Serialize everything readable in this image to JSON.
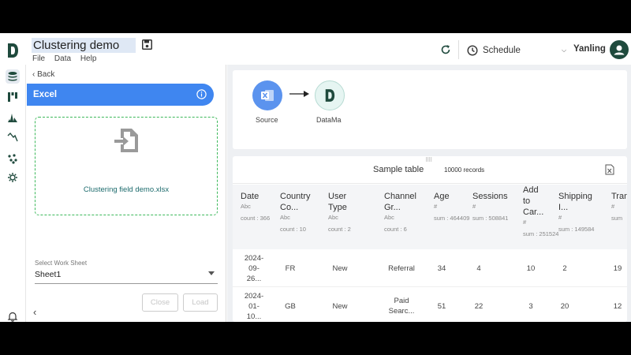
{
  "header": {
    "title": "Clustering demo",
    "menu": [
      "File",
      "Data",
      "Help"
    ],
    "schedule_label": "Schedule",
    "user_name": "Yanling"
  },
  "panel": {
    "back_label": "Back",
    "source_type": "Excel",
    "file_name": "Clustering field demo.xlsx",
    "worksheet_label": "Select Work Sheet",
    "worksheet_value": "Sheet1",
    "close_label": "Close",
    "load_label": "Load"
  },
  "flow": {
    "source_label": "Source",
    "target_label": "DataMa"
  },
  "table": {
    "title": "Sample table",
    "record_count": "10000 records",
    "columns": [
      {
        "name": [
          "Date"
        ],
        "type": "Abc",
        "stat": "count : 366"
      },
      {
        "name": [
          "Country",
          "Co..."
        ],
        "type": "Abc",
        "stat": "count : 10"
      },
      {
        "name": [
          "User",
          "Type"
        ],
        "type": "Abc",
        "stat": "count : 2"
      },
      {
        "name": [
          "Channel",
          "Gr..."
        ],
        "type": "Abc",
        "stat": "count : 6"
      },
      {
        "name": [
          "Age"
        ],
        "type": "#",
        "stat": "sum : 464409"
      },
      {
        "name": [
          "Sessions"
        ],
        "type": "#",
        "stat": "sum : 508841"
      },
      {
        "name": [
          "Add",
          "to",
          "Car..."
        ],
        "type": "#",
        "stat": "sum : 251524"
      },
      {
        "name": [
          "Shipping",
          "I..."
        ],
        "type": "#",
        "stat": "sum : 149584"
      },
      {
        "name": [
          "Tran"
        ],
        "type": "#",
        "stat": "sum"
      }
    ],
    "rows": [
      [
        [
          "2024-",
          "09-",
          "26..."
        ],
        [
          "FR"
        ],
        [
          "New"
        ],
        [
          "Referral"
        ],
        [
          "34"
        ],
        [
          "4"
        ],
        [
          "10"
        ],
        [
          "2"
        ],
        [
          "19"
        ]
      ],
      [
        [
          "2024-",
          "01-",
          "10..."
        ],
        [
          "GB"
        ],
        [
          "New"
        ],
        [
          "Paid",
          "Searc..."
        ],
        [
          "51"
        ],
        [
          "22"
        ],
        [
          "3"
        ],
        [
          "20"
        ],
        [
          "12"
        ]
      ]
    ]
  },
  "colors": {
    "accent": "#3f86f0",
    "dropzone_border": "#3cb85a",
    "brand_dark": "#1f4a3d"
  }
}
